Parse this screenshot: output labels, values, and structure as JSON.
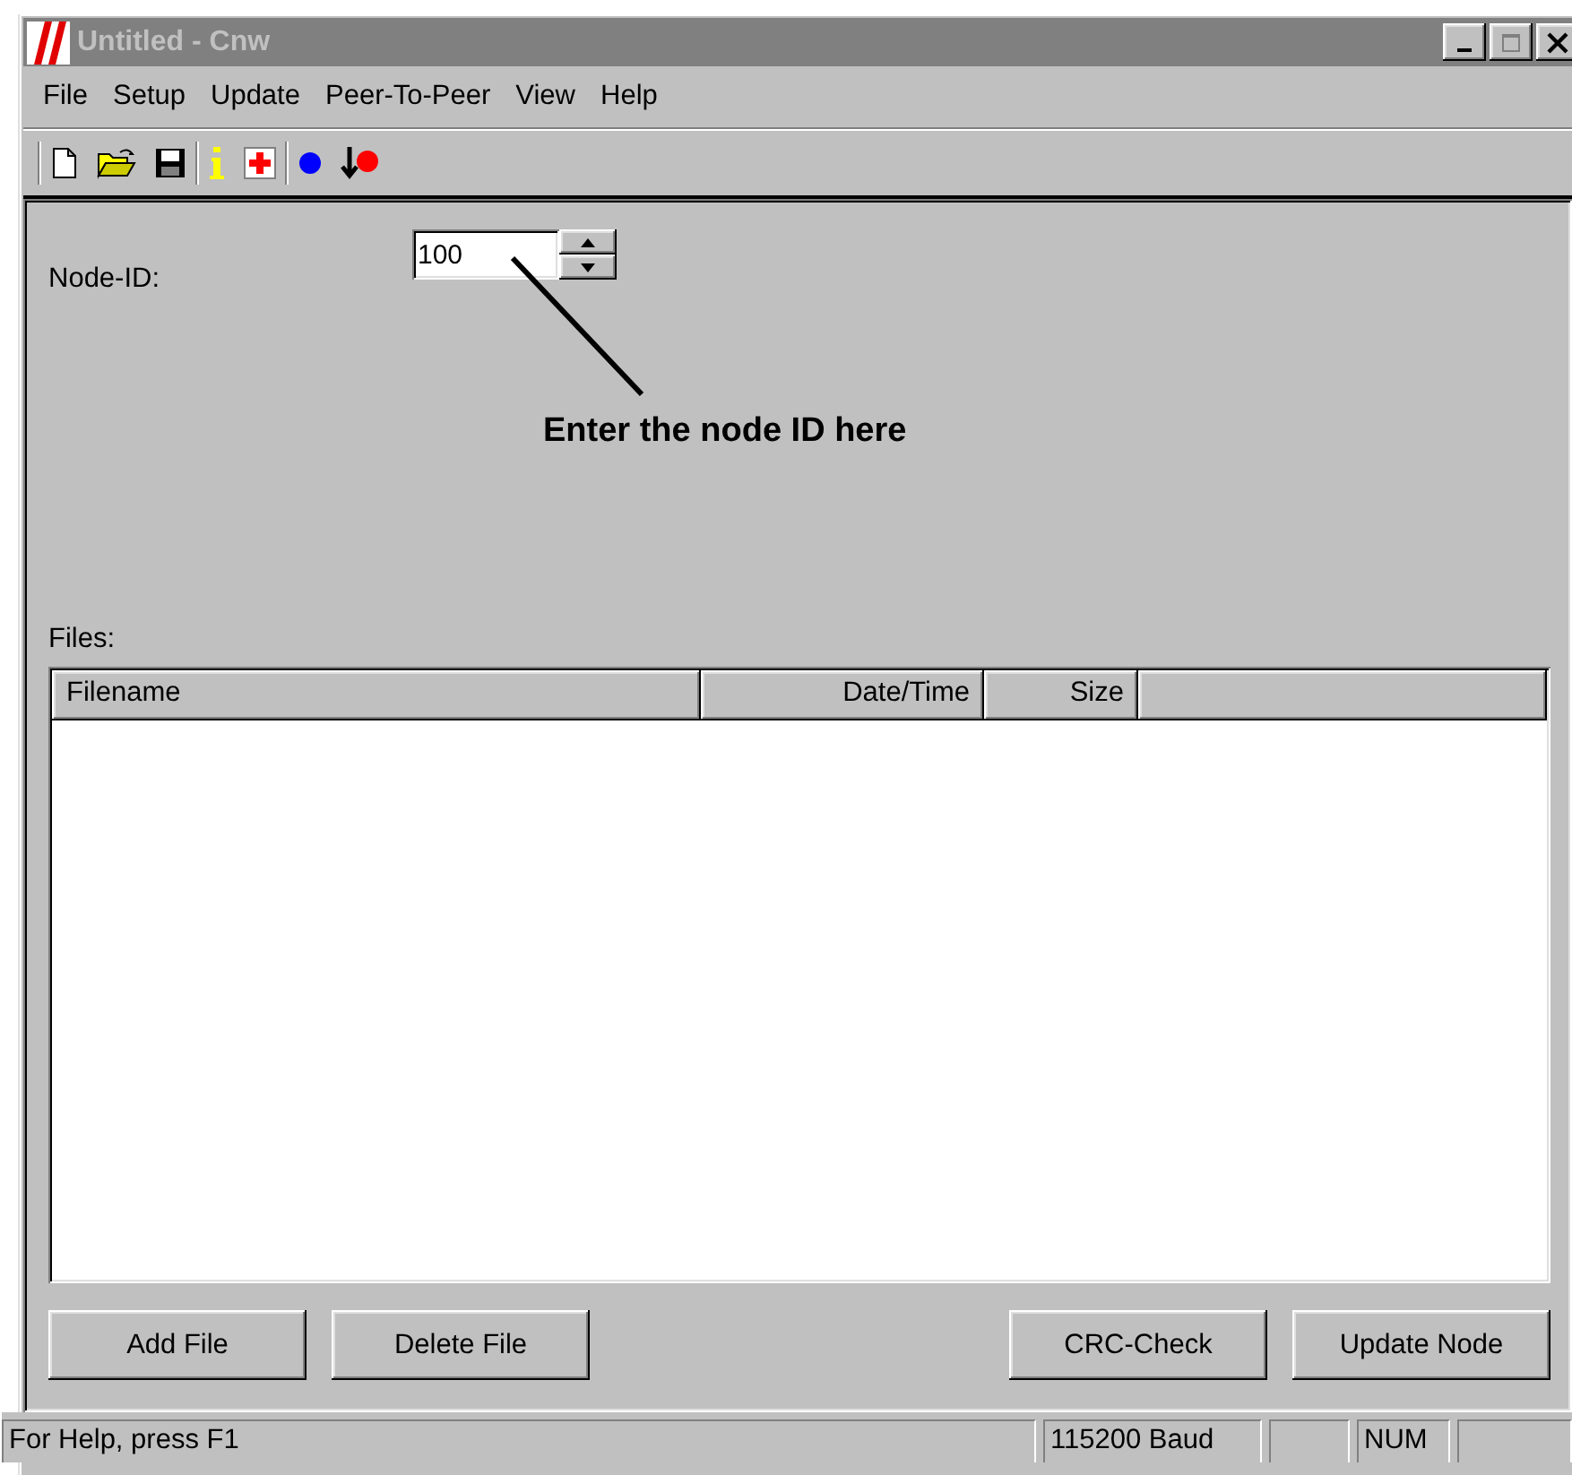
{
  "window": {
    "title": "Untitled - Cnw",
    "active": false
  },
  "menu": [
    {
      "label": "File"
    },
    {
      "label": "Setup"
    },
    {
      "label": "Update"
    },
    {
      "label": "Peer-To-Peer"
    },
    {
      "label": "View"
    },
    {
      "label": "Help"
    }
  ],
  "toolbar": [
    {
      "tools": [
        {
          "kind": "new"
        },
        {
          "kind": "open"
        },
        {
          "kind": "save"
        }
      ]
    },
    {
      "tools": [
        {
          "kind": "info"
        },
        {
          "kind": "add"
        }
      ]
    },
    {
      "tools": [
        {
          "kind": "connect"
        },
        {
          "kind": "download"
        }
      ]
    }
  ],
  "node_id": {
    "label": "Node-ID:",
    "value": "100"
  },
  "annotation": {
    "text": "Enter the node ID here"
  },
  "files": {
    "label": "Files:",
    "columns": [
      {
        "label": "Filename"
      },
      {
        "label": "Date/Time"
      },
      {
        "label": "Size"
      }
    ]
  },
  "buttons_left": [
    {
      "label": "Add File"
    },
    {
      "label": "Delete File"
    }
  ],
  "buttons_right": [
    {
      "label": "CRC-Check"
    },
    {
      "label": "Update Node"
    }
  ],
  "status_bar": {
    "message": "For Help, press F1",
    "baud": "115200 Baud",
    "num": "NUM"
  }
}
